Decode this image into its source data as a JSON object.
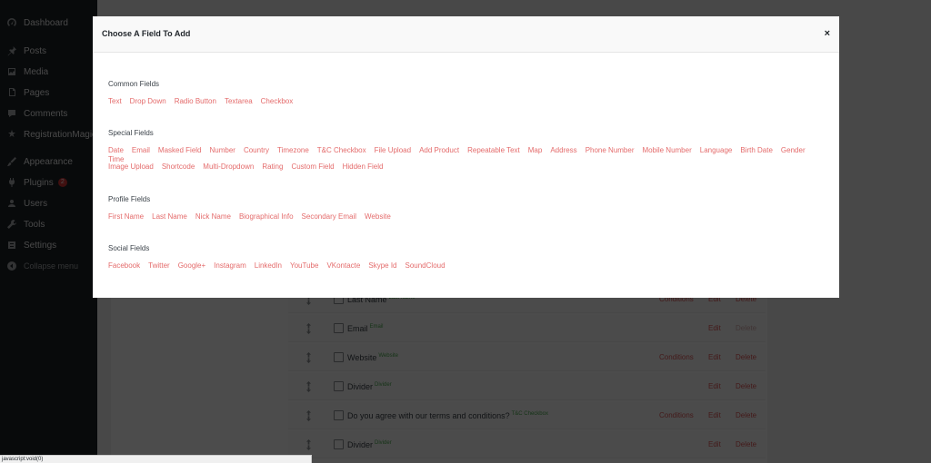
{
  "sidebar": {
    "items": [
      {
        "label": "Dashboard",
        "icon": "dashboard-icon"
      },
      {
        "label": "Posts",
        "icon": "pin-icon"
      },
      {
        "label": "Media",
        "icon": "media-icon"
      },
      {
        "label": "Pages",
        "icon": "pages-icon"
      },
      {
        "label": "Comments",
        "icon": "comments-icon"
      },
      {
        "label": "RegistrationMagic",
        "icon": "registrationmagic-icon"
      },
      {
        "label": "Appearance",
        "icon": "brush-icon"
      },
      {
        "label": "Plugins",
        "icon": "plugins-icon",
        "badge": "2"
      },
      {
        "label": "Users",
        "icon": "users-icon"
      },
      {
        "label": "Tools",
        "icon": "tools-icon"
      },
      {
        "label": "Settings",
        "icon": "settings-icon"
      }
    ],
    "collapse_label": "Collapse menu"
  },
  "form_fields": [
    {
      "label": "Last Name",
      "type": "Last Name",
      "conditions": "Conditions",
      "edit": "Edit",
      "delete": "Delete"
    },
    {
      "label": "Email",
      "type": "Email",
      "conditions": "",
      "edit": "Edit",
      "delete": "Delete"
    },
    {
      "label": "Website",
      "type": "Website",
      "conditions": "Conditions",
      "edit": "Edit",
      "delete": "Delete"
    },
    {
      "label": "Divider",
      "type": "Divider",
      "conditions": "",
      "edit": "Edit",
      "delete": "Delete"
    },
    {
      "label": "Do you agree with our terms and conditions?",
      "type": "T&C Checkbox",
      "conditions": "Conditions",
      "edit": "Edit",
      "delete": "Delete"
    },
    {
      "label": "Divider",
      "type": "Divider",
      "conditions": "",
      "edit": "Edit",
      "delete": "Delete"
    }
  ],
  "modal": {
    "title": "Choose A Field To Add",
    "close": "×",
    "groups": [
      {
        "title": "Common Fields",
        "lines": [
          [
            "Text",
            "Drop Down",
            "Radio Button",
            "Textarea",
            "Checkbox"
          ]
        ]
      },
      {
        "title": "Special Fields",
        "lines": [
          [
            "Date",
            "Email",
            "Masked Field",
            "Number",
            "Country",
            "Timezone",
            "T&C Checkbox",
            "File Upload",
            "Add Product",
            "Repeatable Text",
            "Map",
            "Address",
            "Phone Number",
            "Mobile Number",
            "Language",
            "Birth Date",
            "Gender",
            "Time"
          ],
          [
            "Image Upload",
            "Shortcode",
            "Multi-Dropdown",
            "Rating",
            "Custom Field",
            "Hidden Field"
          ]
        ]
      },
      {
        "title": "Profile Fields",
        "lines": [
          [
            "First Name",
            "Last Name",
            "Nick Name",
            "Biographical Info",
            "Secondary Email",
            "Website"
          ]
        ]
      },
      {
        "title": "Social Fields",
        "lines": [
          [
            "Facebook",
            "Twitter",
            "Google+",
            "Instagram",
            "LinkedIn",
            "YouTube",
            "VKontacte",
            "Skype Id",
            "SoundCloud"
          ]
        ]
      }
    ]
  },
  "status_bar": "javascript:void(0)"
}
